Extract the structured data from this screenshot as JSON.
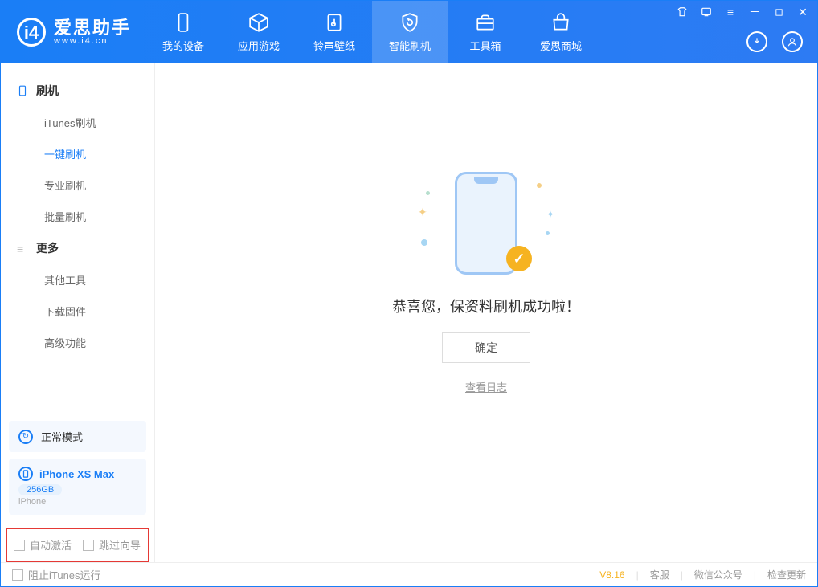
{
  "app": {
    "name": "爱思助手",
    "site": "www.i4.cn"
  },
  "tabs": {
    "device": "我的设备",
    "apps": "应用游戏",
    "ring": "铃声壁纸",
    "flash": "智能刷机",
    "tools": "工具箱",
    "store": "爱思商城"
  },
  "sidebar": {
    "group_flash": "刷机",
    "items_flash": [
      "iTunes刷机",
      "一键刷机",
      "专业刷机",
      "批量刷机"
    ],
    "group_more": "更多",
    "items_more": [
      "其他工具",
      "下载固件",
      "高级功能"
    ]
  },
  "mode": {
    "label": "正常模式"
  },
  "device": {
    "name": "iPhone XS Max",
    "storage": "256GB",
    "type": "iPhone"
  },
  "options": {
    "auto_activate": "自动激活",
    "skip_wizard": "跳过向导"
  },
  "main": {
    "success": "恭喜您，保资料刷机成功啦！",
    "ok": "确定",
    "view_log": "查看日志"
  },
  "footer": {
    "block_itunes": "阻止iTunes运行",
    "version": "V8.16",
    "support": "客服",
    "wechat": "微信公众号",
    "check_update": "检查更新"
  }
}
